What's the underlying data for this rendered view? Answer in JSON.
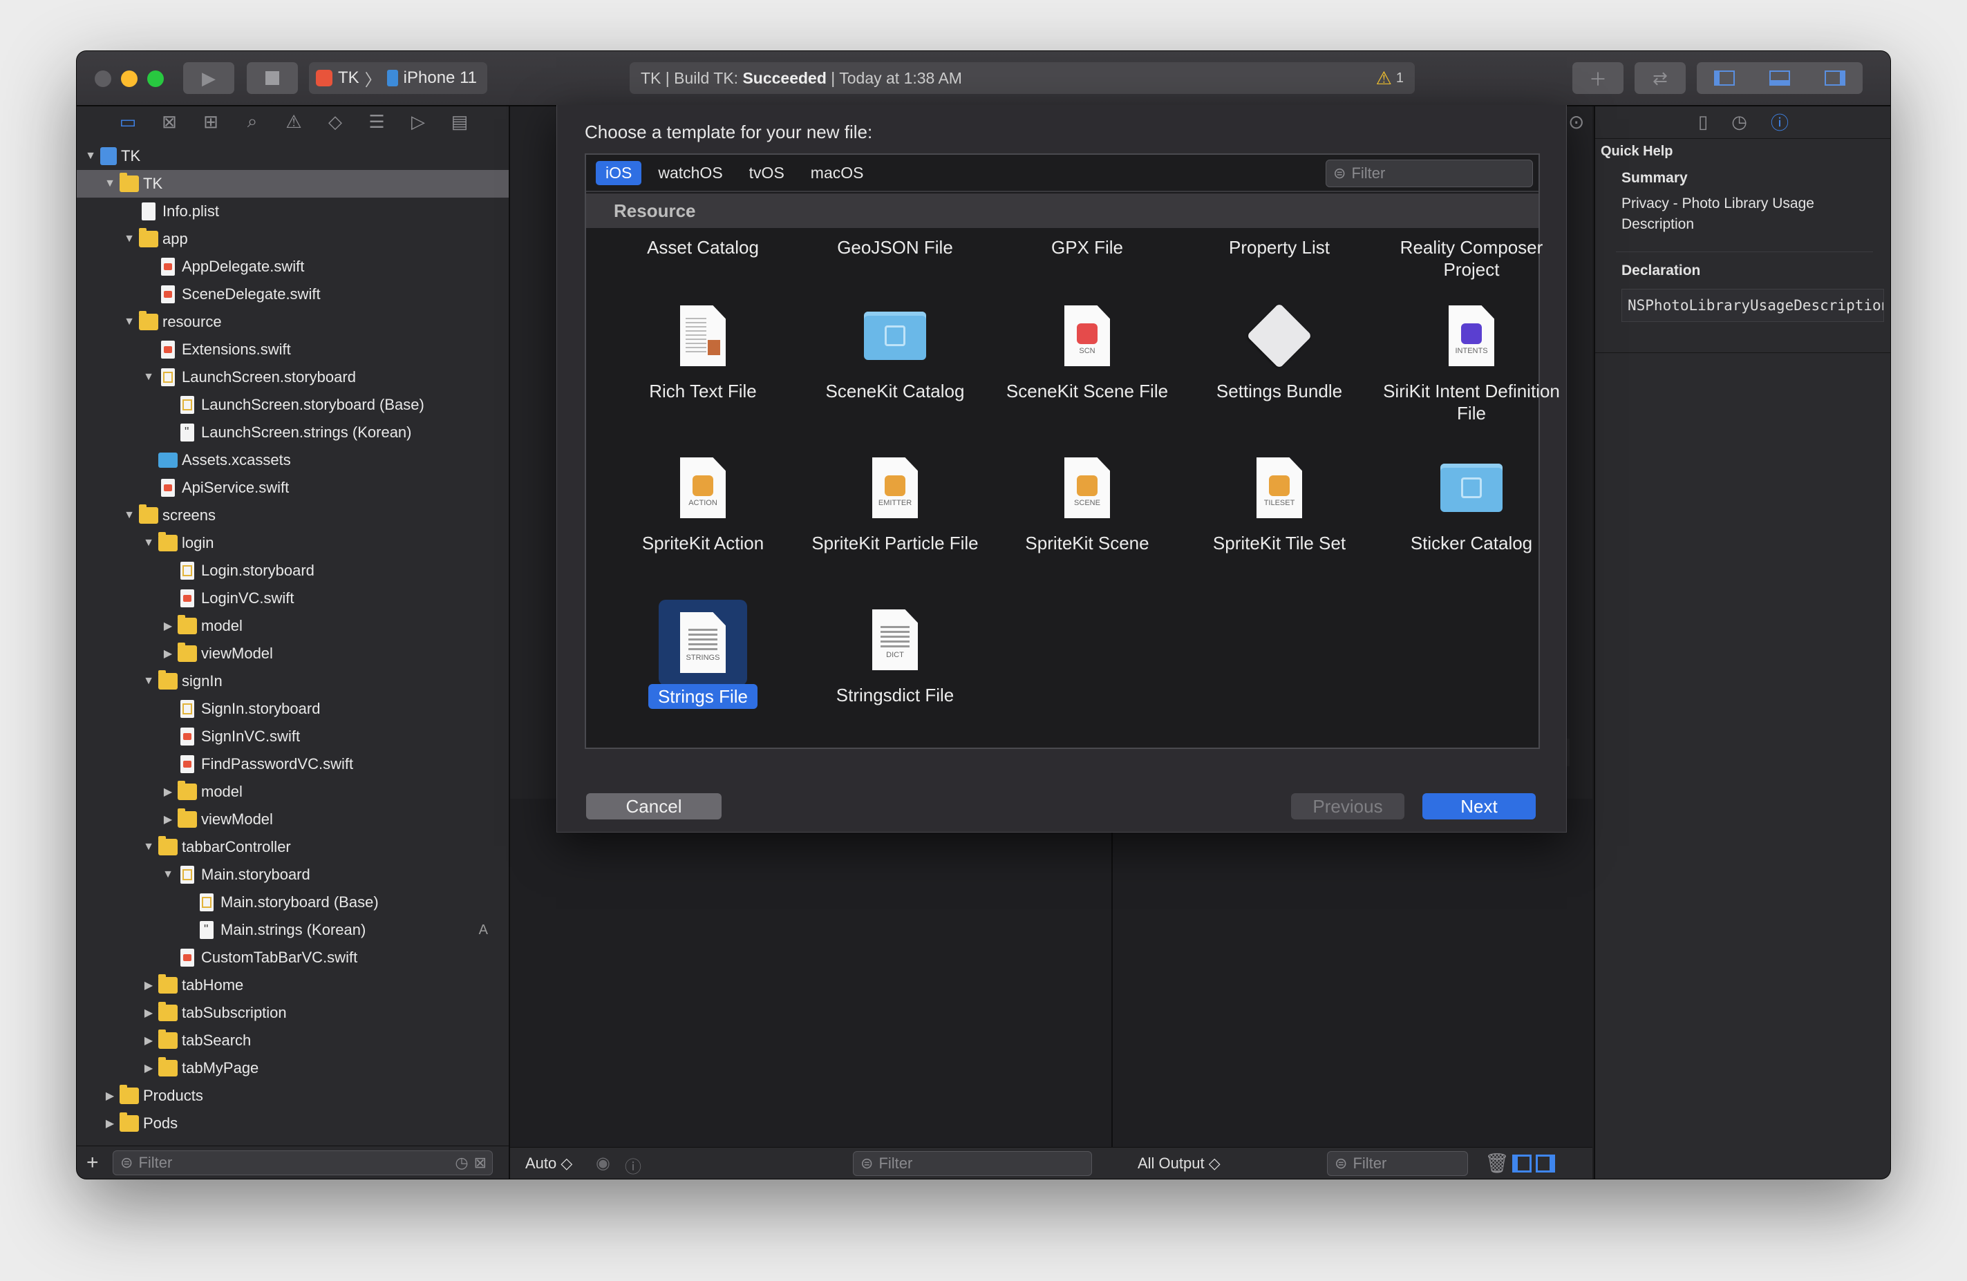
{
  "toolbar": {
    "scheme_project": "TK",
    "scheme_device": "iPhone 11",
    "activity_prefix": "TK | Build TK: ",
    "activity_status": "Succeeded",
    "activity_time": " | Today at 1:38 AM",
    "warning_count": "1"
  },
  "navigator": {
    "filter_placeholder": "Filter",
    "add_label": "+",
    "tree": [
      {
        "label": "TK",
        "depth": 0,
        "kind": "project",
        "tri": "open",
        "badge": ""
      },
      {
        "label": "TK",
        "depth": 1,
        "kind": "folder",
        "tri": "open",
        "badge": ""
      },
      {
        "label": "Info.plist",
        "depth": 2,
        "kind": "file",
        "tri": "",
        "badge": ""
      },
      {
        "label": "app",
        "depth": 2,
        "kind": "folder",
        "tri": "open",
        "badge": ""
      },
      {
        "label": "AppDelegate.swift",
        "depth": 3,
        "kind": "swift",
        "tri": "",
        "badge": ""
      },
      {
        "label": "SceneDelegate.swift",
        "depth": 3,
        "kind": "swift",
        "tri": "",
        "badge": ""
      },
      {
        "label": "resource",
        "depth": 2,
        "kind": "folder",
        "tri": "open",
        "badge": ""
      },
      {
        "label": "Extensions.swift",
        "depth": 3,
        "kind": "swift",
        "tri": "",
        "badge": ""
      },
      {
        "label": "LaunchScreen.storyboard",
        "depth": 3,
        "kind": "storyboard",
        "tri": "open",
        "badge": ""
      },
      {
        "label": "LaunchScreen.storyboard (Base)",
        "depth": 4,
        "kind": "storyboard",
        "tri": "",
        "badge": ""
      },
      {
        "label": "LaunchScreen.strings (Korean)",
        "depth": 4,
        "kind": "strings",
        "tri": "",
        "badge": ""
      },
      {
        "label": "Assets.xcassets",
        "depth": 3,
        "kind": "xcassets",
        "tri": "",
        "badge": ""
      },
      {
        "label": "ApiService.swift",
        "depth": 3,
        "kind": "swift",
        "tri": "",
        "badge": ""
      },
      {
        "label": "screens",
        "depth": 2,
        "kind": "folder",
        "tri": "open",
        "badge": ""
      },
      {
        "label": "login",
        "depth": 3,
        "kind": "folder",
        "tri": "open",
        "badge": ""
      },
      {
        "label": "Login.storyboard",
        "depth": 4,
        "kind": "storyboard",
        "tri": "",
        "badge": ""
      },
      {
        "label": "LoginVC.swift",
        "depth": 4,
        "kind": "swift",
        "tri": "",
        "badge": ""
      },
      {
        "label": "model",
        "depth": 4,
        "kind": "folder",
        "tri": "closed",
        "badge": ""
      },
      {
        "label": "viewModel",
        "depth": 4,
        "kind": "folder",
        "tri": "closed",
        "badge": ""
      },
      {
        "label": "signIn",
        "depth": 3,
        "kind": "folder",
        "tri": "open",
        "badge": ""
      },
      {
        "label": "SignIn.storyboard",
        "depth": 4,
        "kind": "storyboard",
        "tri": "",
        "badge": ""
      },
      {
        "label": "SignInVC.swift",
        "depth": 4,
        "kind": "swift",
        "tri": "",
        "badge": ""
      },
      {
        "label": "FindPasswordVC.swift",
        "depth": 4,
        "kind": "swift",
        "tri": "",
        "badge": ""
      },
      {
        "label": "model",
        "depth": 4,
        "kind": "folder",
        "tri": "closed",
        "badge": ""
      },
      {
        "label": "viewModel",
        "depth": 4,
        "kind": "folder",
        "tri": "closed",
        "badge": ""
      },
      {
        "label": "tabbarController",
        "depth": 3,
        "kind": "folder",
        "tri": "open",
        "badge": ""
      },
      {
        "label": "Main.storyboard",
        "depth": 4,
        "kind": "storyboard",
        "tri": "open",
        "badge": ""
      },
      {
        "label": "Main.storyboard (Base)",
        "depth": 5,
        "kind": "storyboard",
        "tri": "",
        "badge": ""
      },
      {
        "label": "Main.strings (Korean)",
        "depth": 5,
        "kind": "strings",
        "tri": "",
        "badge": "A"
      },
      {
        "label": "CustomTabBarVC.swift",
        "depth": 4,
        "kind": "swift",
        "tri": "",
        "badge": ""
      },
      {
        "label": "tabHome",
        "depth": 3,
        "kind": "folder",
        "tri": "closed",
        "badge": ""
      },
      {
        "label": "tabSubscription",
        "depth": 3,
        "kind": "folder",
        "tri": "closed",
        "badge": ""
      },
      {
        "label": "tabSearch",
        "depth": 3,
        "kind": "folder",
        "tri": "closed",
        "badge": ""
      },
      {
        "label": "tabMyPage",
        "depth": 3,
        "kind": "folder",
        "tri": "closed",
        "badge": ""
      },
      {
        "label": "Products",
        "depth": 1,
        "kind": "folder",
        "tri": "closed",
        "badge": ""
      },
      {
        "label": "Pods",
        "depth": 1,
        "kind": "folder",
        "tri": "closed",
        "badge": ""
      }
    ]
  },
  "debug": {
    "auto_label": "Auto ◇",
    "filter_placeholder": "Filter",
    "output_label": "All Output ◇",
    "output_filter_placeholder": "Filter"
  },
  "inspector": {
    "quick_help": "Quick Help",
    "summary_label": "Summary",
    "summary_text": "Privacy - Photo Library Usage Description",
    "declaration_label": "Declaration",
    "declaration_text": "NSPhotoLibraryUsageDescription"
  },
  "sheet": {
    "title": "Choose a template for your new file:",
    "tabs": [
      "iOS",
      "watchOS",
      "tvOS",
      "macOS"
    ],
    "active_tab": "iOS",
    "filter_placeholder": "Filter",
    "section": "Resource",
    "top_labels": [
      "Asset Catalog",
      "GeoJSON File",
      "GPX File",
      "Property List",
      "Reality Composer Project"
    ],
    "templates": [
      {
        "label": "Rich Text File",
        "icon": "rich-text-document-icon",
        "caption": ""
      },
      {
        "label": "SceneKit Catalog",
        "icon": "scenekit-catalog-folder-icon",
        "caption": ""
      },
      {
        "label": "SceneKit Scene File",
        "icon": "scenekit-scene-document-icon",
        "caption": "SCN"
      },
      {
        "label": "Settings Bundle",
        "icon": "settings-bundle-lego-icon",
        "caption": ""
      },
      {
        "label": "SiriKit Intent Definition File",
        "icon": "sirikit-intents-document-icon",
        "caption": "INTENTS"
      },
      {
        "label": "SpriteKit Action",
        "icon": "spritekit-action-document-icon",
        "caption": "ACTION"
      },
      {
        "label": "SpriteKit Particle File",
        "icon": "spritekit-emitter-document-icon",
        "caption": "EMITTER"
      },
      {
        "label": "SpriteKit Scene",
        "icon": "spritekit-scene-document-icon",
        "caption": "SCENE"
      },
      {
        "label": "SpriteKit Tile Set",
        "icon": "spritekit-tileset-document-icon",
        "caption": "TILESET"
      },
      {
        "label": "Sticker Catalog",
        "icon": "sticker-catalog-folder-icon",
        "caption": ""
      },
      {
        "label": "Strings File",
        "icon": "strings-document-icon",
        "caption": "STRINGS"
      },
      {
        "label": "Stringsdict File",
        "icon": "stringsdict-document-icon",
        "caption": "DICT"
      }
    ],
    "selected": "Strings File",
    "cancel": "Cancel",
    "previous": "Previous",
    "next": "Next"
  },
  "colors": {
    "accent": "#2f6fe3",
    "folder": "#f0c23a",
    "swift": "#e8543b",
    "close": "#ff5f57",
    "minimize": "#febc2e",
    "zoom": "#28c840"
  }
}
